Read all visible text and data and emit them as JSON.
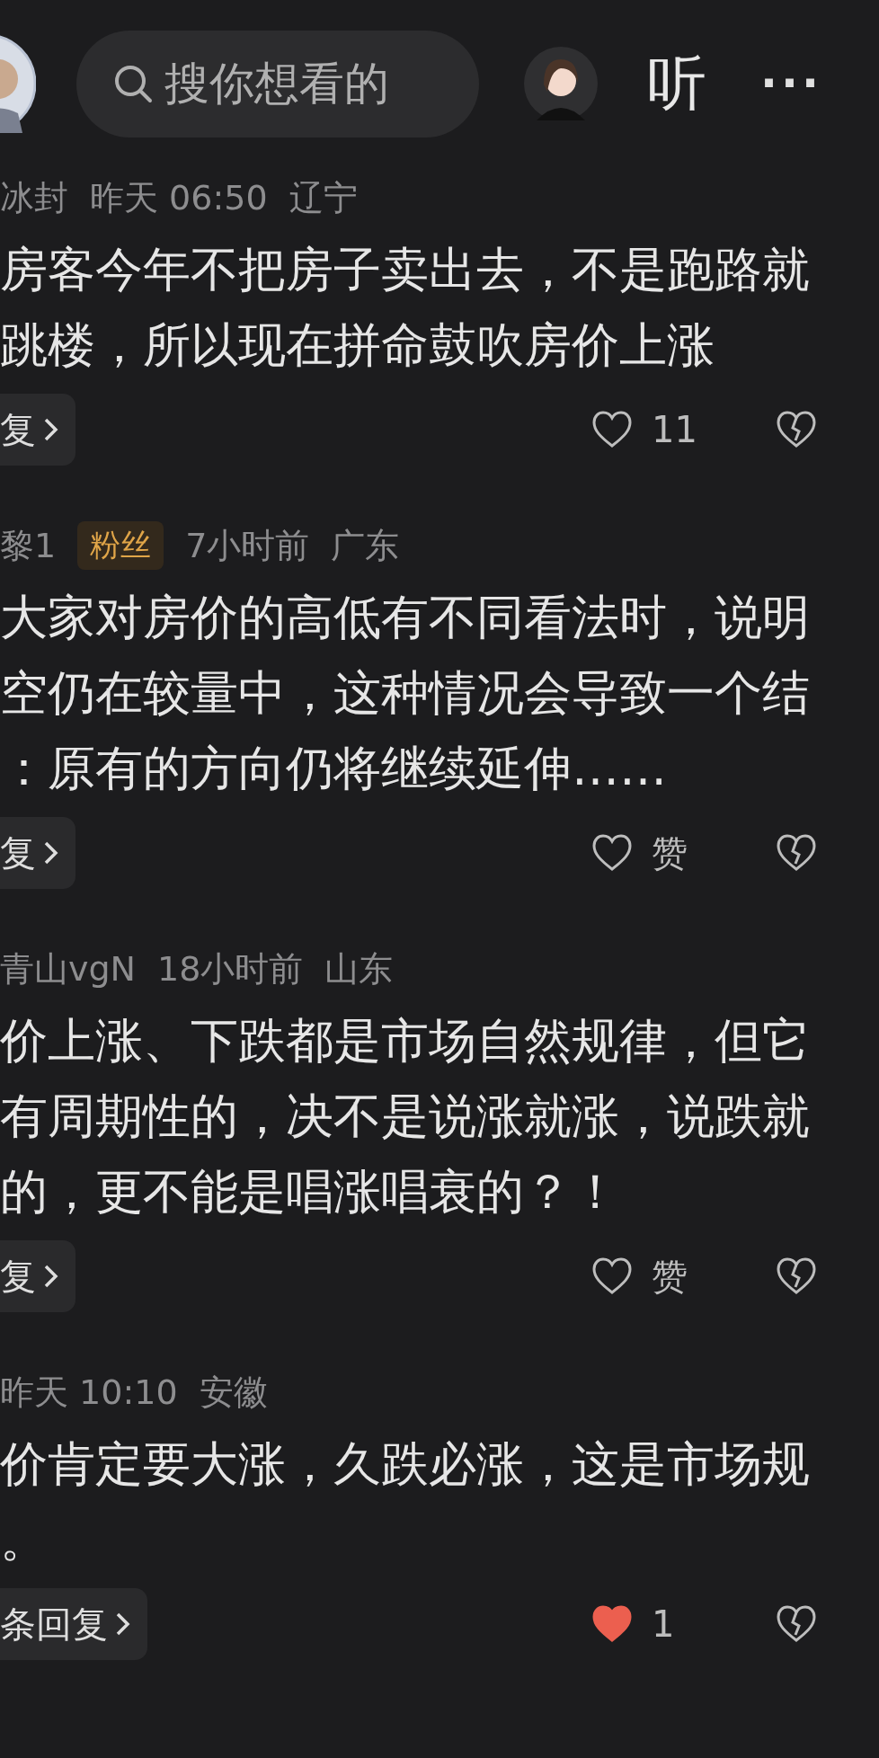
{
  "top_bar": {
    "search": {
      "placeholder": "搜你想看的"
    },
    "listen_label": "听",
    "more_label": "···"
  },
  "comments": [
    {
      "user": "冰封",
      "time": "昨天 06:50",
      "location": "辽宁",
      "lines": [
        "房客今年不把房子卖出去，不是跑路就",
        "跳楼，所以现在拼命鼓吹房价上涨"
      ],
      "reply_label": "复",
      "liked": false,
      "like_label": "11"
    },
    {
      "user": "黎1",
      "badge": "粉丝",
      "time": "7小时前",
      "location": "广东",
      "lines": [
        "大家对房价的高低有不同看法时，说明",
        "空仍在较量中，这种情况会导致一个结",
        "：原有的方向仍将继续延伸……"
      ],
      "reply_label": "复",
      "liked": false,
      "like_label": "赞"
    },
    {
      "user": "青山vgN",
      "time": "18小时前",
      "location": "山东",
      "lines": [
        "价上涨、下跌都是市场自然规律，但它",
        "有周期性的，决不是说涨就涨，说跌就",
        "的，更不能是唱涨唱衰的？！"
      ],
      "reply_label": "复",
      "liked": false,
      "like_label": "赞"
    },
    {
      "time": "昨天 10:10",
      "location": "安徽",
      "lines": [
        "价肯定要大涨，久跌必涨，这是市场规",
        "。"
      ],
      "reply_label": "条回复",
      "liked": true,
      "like_label": "1"
    }
  ]
}
